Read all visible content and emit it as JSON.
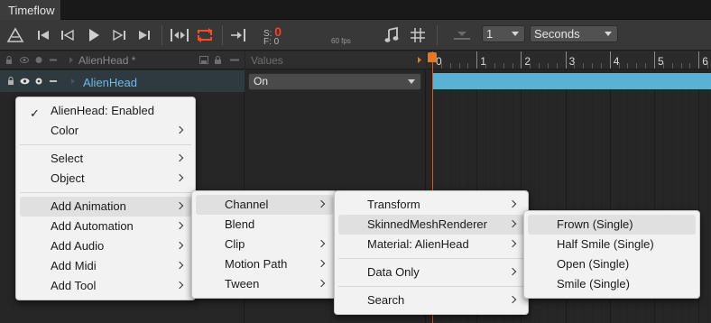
{
  "window": {
    "tab_title": "Timeflow"
  },
  "toolbar": {
    "s_label": "S:",
    "s_value": "0",
    "f_label": "F:",
    "f_value": "0",
    "fps": "60 fps",
    "step_value": "1",
    "unit_value": "Seconds"
  },
  "track_header": {
    "title": "AlienHead *",
    "values_label": "Values"
  },
  "track": {
    "name": "AlienHead",
    "value": "On"
  },
  "ruler": {
    "labels": [
      "0",
      "1",
      "2",
      "3",
      "4",
      "5",
      "6"
    ]
  },
  "menus": {
    "main": {
      "items": [
        {
          "label": "AlienHead: Enabled",
          "checked": true
        },
        {
          "label": "Color",
          "submenu": true
        },
        {
          "label": "Select",
          "submenu": true
        },
        {
          "label": "Object",
          "submenu": true
        },
        {
          "label": "Add Animation",
          "submenu": true,
          "highlighted": true
        },
        {
          "label": "Add Automation",
          "submenu": true
        },
        {
          "label": "Add Audio",
          "submenu": true
        },
        {
          "label": "Add Midi",
          "submenu": true
        },
        {
          "label": "Add Tool",
          "submenu": true
        }
      ]
    },
    "animation": {
      "items": [
        {
          "label": "Channel",
          "submenu": true,
          "highlighted": true
        },
        {
          "label": "Blend"
        },
        {
          "label": "Clip",
          "submenu": true
        },
        {
          "label": "Motion Path",
          "submenu": true
        },
        {
          "label": "Tween",
          "submenu": true
        }
      ]
    },
    "channel": {
      "items": [
        {
          "label": "Transform",
          "submenu": true
        },
        {
          "label": "SkinnedMeshRenderer",
          "submenu": true,
          "highlighted": true
        },
        {
          "label": "Material: AlienHead",
          "submenu": true
        },
        {
          "label": "Data Only",
          "submenu": true
        },
        {
          "label": "Search",
          "submenu": true
        }
      ]
    },
    "skinned": {
      "items": [
        {
          "label": "Frown (Single)",
          "highlighted": true
        },
        {
          "label": "Half Smile (Single)"
        },
        {
          "label": "Open (Single)"
        },
        {
          "label": "Smile (Single)"
        }
      ]
    }
  }
}
